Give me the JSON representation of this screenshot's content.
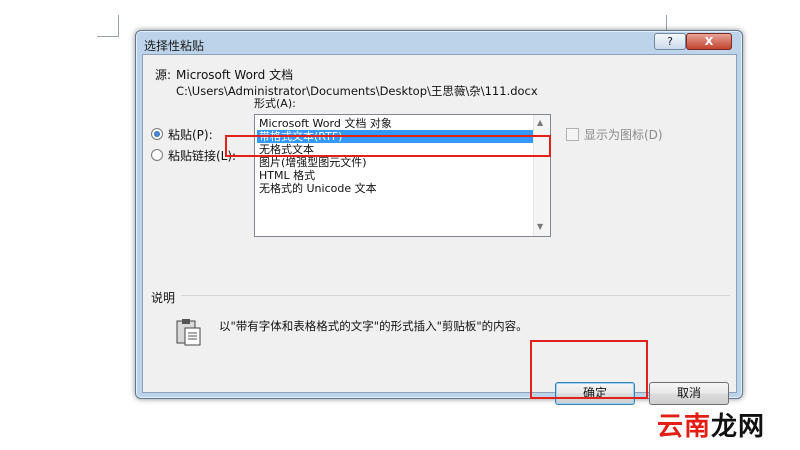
{
  "dialog": {
    "title": "选择性粘贴",
    "help_label": "?",
    "close_label": "X",
    "source_label": "源:",
    "source_app": "Microsoft Word 文档",
    "source_path": "C:\\Users\\Administrator\\Documents\\Desktop\\王思薇\\杂\\111.docx",
    "as_label": "形式(A):",
    "radio_paste": "粘贴(P):",
    "radio_paste_link": "粘贴链接(L):",
    "display_as_icon": "显示为图标(D)",
    "formats": [
      "Microsoft Word 文档 对象",
      "带格式文本(RTF)",
      "无格式文本",
      "图片(增强型图元文件)",
      "HTML 格式",
      "无格式的 Unicode 文本"
    ],
    "selected_format": "带格式文本(RTF)",
    "result_label": "说明",
    "result_text": "以\"带有字体和表格格式的文字\"的形式插入\"剪贴板\"的内容。",
    "ok_label": "确定",
    "cancel_label": "取消"
  },
  "watermark": {
    "part1": "云南",
    "part2": "龙网"
  },
  "colors": {
    "highlight_red": "#e0211c",
    "selection_blue": "#3399ff"
  }
}
